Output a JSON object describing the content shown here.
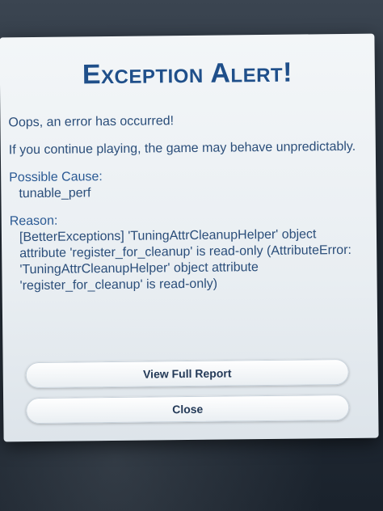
{
  "dialog": {
    "title": "Exception Alert!",
    "line1": "Oops, an error has occurred!",
    "line2": "If you continue playing, the game may behave unpredictably.",
    "cause_label": "Possible Cause:",
    "cause_value": "tunable_perf",
    "reason_label": "Reason:",
    "reason_value": "[BetterExceptions] 'TuningAttrCleanupHelper' object attribute 'register_for_cleanup' is read-only (AttributeError: 'TuningAttrCleanupHelper' object attribute 'register_for_cleanup' is read-only)"
  },
  "buttons": {
    "view_full_report": "View Full Report",
    "close": "Close"
  }
}
